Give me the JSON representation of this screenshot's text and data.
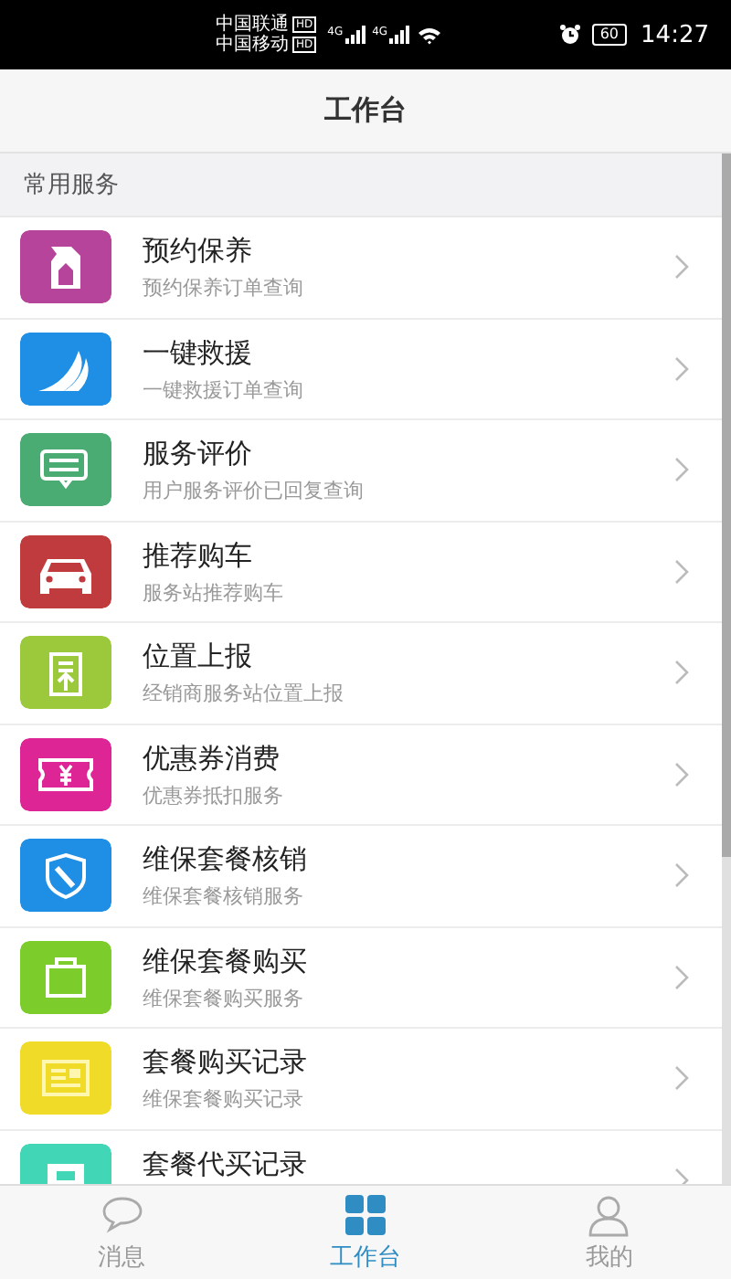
{
  "status_bar": {
    "carriers": [
      {
        "name": "中国联通",
        "badge": "HD",
        "network": "4G"
      },
      {
        "name": "中国移动",
        "badge": "HD",
        "network": "4G"
      }
    ],
    "battery": "60",
    "time": "14:27"
  },
  "header": {
    "title": "工作台"
  },
  "section": {
    "title": "常用服务"
  },
  "services": [
    {
      "title": "预约保养",
      "subtitle": "预约保养订单查询",
      "color": "#b5449a"
    },
    {
      "title": "一键救援",
      "subtitle": "一键救援订单查询",
      "color": "#1f8fe6"
    },
    {
      "title": "服务评价",
      "subtitle": "用户服务评价已回复查询",
      "color": "#4aac72"
    },
    {
      "title": "推荐购车",
      "subtitle": "服务站推荐购车",
      "color": "#bf3b3d"
    },
    {
      "title": "位置上报",
      "subtitle": "经销商服务站位置上报",
      "color": "#9cc83c"
    },
    {
      "title": "优惠券消费",
      "subtitle": "优惠券抵扣服务",
      "color": "#de2596"
    },
    {
      "title": "维保套餐核销",
      "subtitle": "维保套餐核销服务",
      "color": "#1f8fe6"
    },
    {
      "title": "维保套餐购买",
      "subtitle": "维保套餐购买服务",
      "color": "#7ccc2c"
    },
    {
      "title": "套餐购买记录",
      "subtitle": "维保套餐购买记录",
      "color": "#f0dc28"
    },
    {
      "title": "套餐代买记录",
      "color": "#40d6b6"
    }
  ],
  "tabs": [
    {
      "label": "消息",
      "selected": false
    },
    {
      "label": "工作台",
      "selected": true
    },
    {
      "label": "我的",
      "selected": false
    }
  ]
}
